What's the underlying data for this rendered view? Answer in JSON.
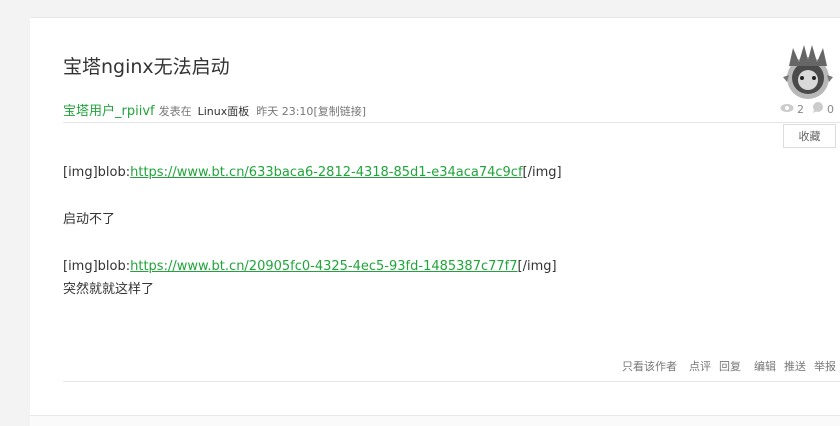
{
  "post": {
    "title": "宝塔nginx无法启动",
    "author": "宝塔用户_rpiivf",
    "posted_in": "发表在",
    "forum": "Linux面板",
    "time": "昨天 23:10",
    "copy_link": "[复制链接]",
    "views": "2",
    "replies": "0",
    "favorite_label": "收藏"
  },
  "content": {
    "line1_prefix": "[img]blob:",
    "line1_link": "https://www.bt.cn/633baca6-2812-4318-85d1-e34aca74c9cf",
    "line1_suffix": "[/img]",
    "line2": "启动不了",
    "line3_prefix": "[img]blob:",
    "line3_link": "https://www.bt.cn/20905fc0-4325-4ec5-93fd-1485387c77f7",
    "line3_suffix": "[/img]",
    "line4": "突然就就这样了"
  },
  "actions": {
    "only_author": "只看该作者",
    "comment": "点评",
    "reply": "回复",
    "edit": "编辑",
    "push": "推送",
    "report": "举报"
  },
  "colors": {
    "accent": "#20a53a"
  },
  "icons": {
    "views": "eye-icon",
    "replies": "comment-bubble-icon"
  }
}
